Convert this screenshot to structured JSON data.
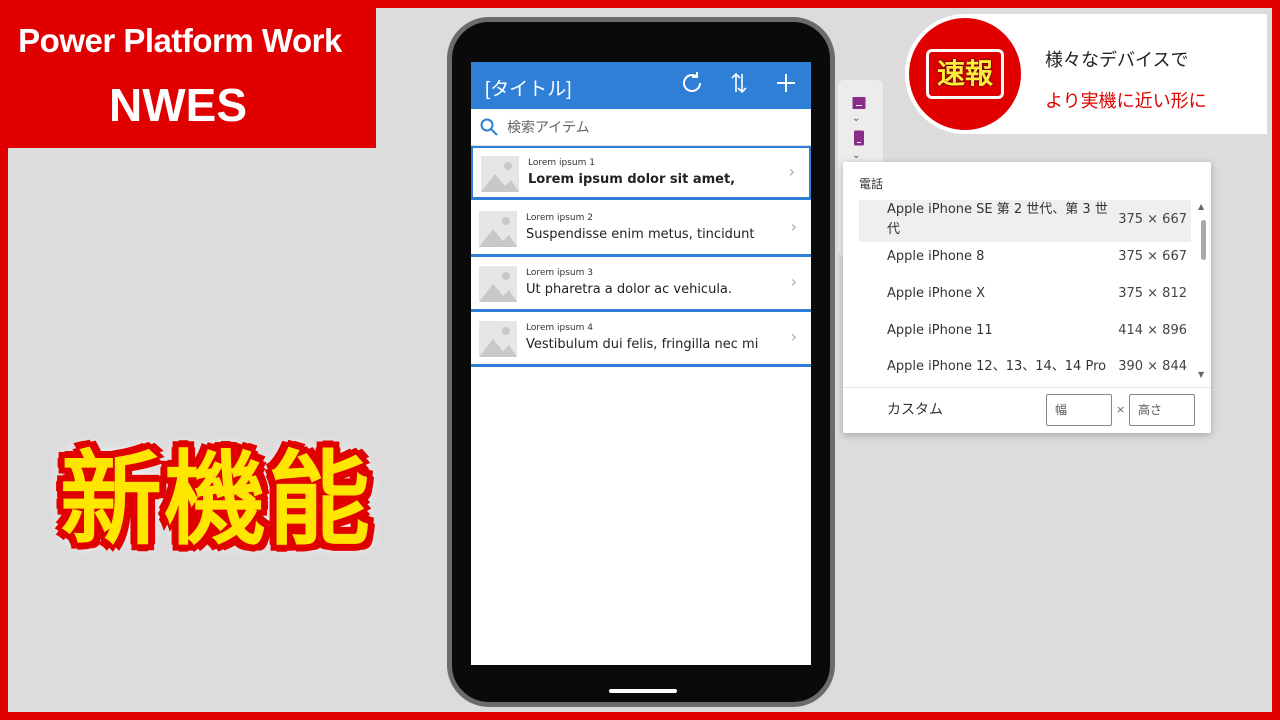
{
  "brand": {
    "line1": "Power Platform Work",
    "line2": "NWES"
  },
  "headline": "新機能",
  "news": {
    "badge": "速報",
    "line1": "様々なデバイスで",
    "line2": "より実機に近い形に"
  },
  "app": {
    "title": "[タイトル]",
    "icons": [
      "refresh-icon",
      "sort-icon",
      "add-icon"
    ],
    "search_placeholder": "検索アイテム",
    "items": [
      {
        "subtitle": "Lorem ipsum 1",
        "title": "Lorem ipsum dolor sit amet,"
      },
      {
        "subtitle": "Lorem ipsum 2",
        "title": "Suspendisse enim metus, tincidunt"
      },
      {
        "subtitle": "Lorem ipsum 3",
        "title": "Ut pharetra a dolor ac vehicula."
      },
      {
        "subtitle": "Lorem ipsum 4",
        "title": "Vestibulum dui felis, fringilla nec mi"
      }
    ]
  },
  "device_menu": {
    "section": "電話",
    "devices": [
      {
        "name": "Apple iPhone SE 第 2 世代、第 3 世代",
        "size": "375 × 667"
      },
      {
        "name": "Apple iPhone 8",
        "size": "375 × 667"
      },
      {
        "name": "Apple iPhone X",
        "size": "375 × 812"
      },
      {
        "name": "Apple iPhone 11",
        "size": "414 × 896"
      },
      {
        "name": "Apple iPhone 12、13、14、14 Pro",
        "size": "390 × 844"
      }
    ],
    "custom_label": "カスタム",
    "width_placeholder": "幅",
    "height_placeholder": "高さ",
    "separator": "×"
  },
  "colors": {
    "accent_red": "#e00000",
    "app_blue": "#2f7fd6",
    "headline_yellow": "#ffe600"
  }
}
